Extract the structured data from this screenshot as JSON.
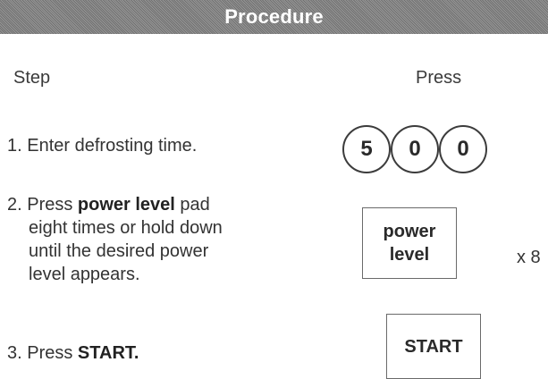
{
  "header": {
    "title": "Procedure"
  },
  "columns": {
    "step": "Step",
    "press": "Press"
  },
  "steps": [
    {
      "prefix": "1. ",
      "text": "Enter defrosting time."
    },
    {
      "line1_prefix": "2. Press ",
      "line1_bold": "power level",
      "line1_suffix": " pad",
      "line2": "eight times or hold down",
      "line3": "until the desired power",
      "line4": "level appears."
    },
    {
      "prefix": "3. Press ",
      "bold": "START."
    }
  ],
  "keys": {
    "digits": [
      "5",
      "0",
      "0"
    ],
    "power_line1": "power",
    "power_line2": "level",
    "times": "x 8",
    "start": "START"
  }
}
